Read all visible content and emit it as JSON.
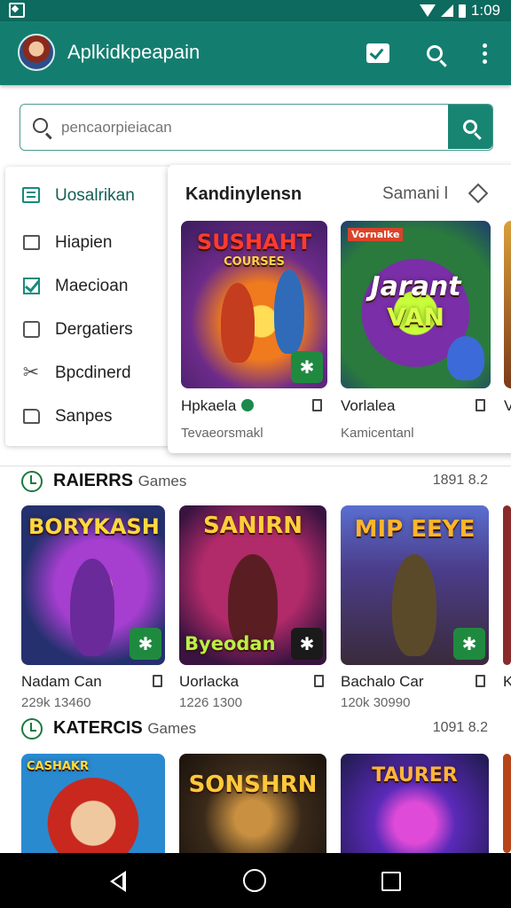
{
  "status_bar": {
    "time": "1:09"
  },
  "app_bar": {
    "title": "Aplkidkpeapain"
  },
  "search": {
    "placeholder": "pencaorpieiacan"
  },
  "side_menu": {
    "items": [
      {
        "label": "Uosalrikan",
        "icon": "list-icon"
      },
      {
        "label": "Hiapien",
        "icon": "image-icon"
      },
      {
        "label": "Maecioan",
        "icon": "checkbox-icon"
      },
      {
        "label": "Dergatiers",
        "icon": "square-icon"
      },
      {
        "label": "Bpcdinerd",
        "icon": "tools-icon"
      },
      {
        "label": "Sanpes",
        "icon": "tag-icon"
      }
    ]
  },
  "featured": {
    "title": "Kandinylensn",
    "subtitle": "Samani l",
    "cards": [
      {
        "art_title": "SUSHAHT",
        "art_subtitle": "COURSES",
        "name": "Hpkaela",
        "meta": "Tevaeorsmakl"
      },
      {
        "art_title": "Jarant",
        "art_subtitle": "VAN",
        "art_tag": "Vornalke",
        "name": "Vorlalea",
        "meta": "Kamicentanl"
      },
      {
        "name": "V"
      }
    ]
  },
  "sections": [
    {
      "title": "RAIERRS",
      "subtitle": "Games",
      "count": "1891 8.2",
      "cards": [
        {
          "art_title": "BORYKASH",
          "name": "Nadam Can",
          "meta": "229k 13460"
        },
        {
          "art_title": "SANIRN",
          "art_footer": "Byeodan",
          "name": "Uorlacka",
          "meta": "1226 1300"
        },
        {
          "art_title": "MIP EEYE",
          "name": "Bachalo Car",
          "meta": "120k 30990"
        },
        {
          "name": "K"
        }
      ]
    },
    {
      "title": "KATERCIS",
      "subtitle": "Games",
      "count": "1091 8.2",
      "cards": [
        {
          "art_title": "CASHAKR"
        },
        {
          "art_title": "SONSHRN"
        },
        {
          "art_title": "TAURER"
        },
        {
          "art_title": ""
        }
      ]
    }
  ]
}
